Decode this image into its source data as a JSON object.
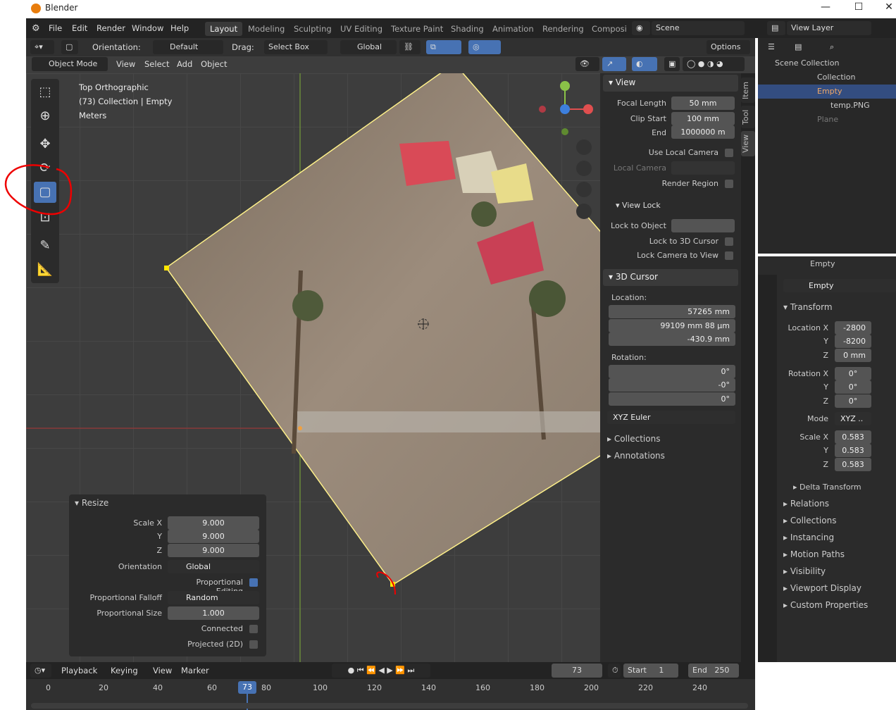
{
  "app": {
    "title": "Blender",
    "scene": "Scene",
    "view_layer": "View Layer"
  },
  "menus": [
    "File",
    "Edit",
    "Render",
    "Window",
    "Help"
  ],
  "workspaces": [
    "Layout",
    "Modeling",
    "Sculpting",
    "UV Editing",
    "Texture Paint",
    "Shading",
    "Animation",
    "Rendering",
    "Composi"
  ],
  "toolheader": {
    "orientation_label": "Orientation:",
    "orientation": "Default",
    "drag_label": "Drag:",
    "drag": "Select Box",
    "transform": "Global",
    "options": "Options"
  },
  "viewheader": {
    "mode": "Object Mode",
    "items": [
      "View",
      "Select",
      "Add",
      "Object"
    ]
  },
  "overlay": {
    "view": "Top Orthographic",
    "collection": "(73) Collection | Empty",
    "units": "Meters"
  },
  "npanel": {
    "view": {
      "title": "View",
      "focal_label": "Focal Length",
      "focal": "50 mm",
      "clip_start_label": "Clip Start",
      "clip_start": "100 mm",
      "end_label": "End",
      "end": "1000000 m",
      "use_local_camera": "Use Local Camera",
      "local_camera": "Local Camera",
      "render_region": "Render Region"
    },
    "view_lock": {
      "title": "View Lock",
      "lock_object": "Lock to Object",
      "lock_cursor": "Lock to 3D Cursor",
      "lock_camera": "Lock Camera to View"
    },
    "cursor": {
      "title": "3D Cursor",
      "location": "Location:",
      "x": "57265 mm",
      "y": "99109 mm 88 µm",
      "z": "-430.9 mm",
      "rotation": "Rotation:",
      "rx": "0°",
      "ry": "-0°",
      "rz": "0°",
      "mode": "XYZ Euler"
    },
    "collections": "Collections",
    "annotations": "Annotations",
    "tabs": [
      "Item",
      "Tool",
      "View"
    ]
  },
  "resize": {
    "title": "Resize",
    "scale_x_label": "Scale X",
    "y_label": "Y",
    "z_label": "Z",
    "sx": "9.000",
    "sy": "9.000",
    "sz": "9.000",
    "orientation_label": "Orientation",
    "orientation": "Global",
    "prop_edit": "Proportional Editing",
    "falloff_label": "Proportional Falloff",
    "falloff": "Random",
    "size_label": "Proportional Size",
    "size": "1.000",
    "connected": "Connected",
    "projected": "Projected (2D)"
  },
  "outliner": {
    "scene_collection": "Scene Collection",
    "collection": "Collection",
    "empty": "Empty",
    "image": "temp.PNG",
    "plane": "Plane"
  },
  "properties": {
    "object": "Empty",
    "name": "Empty",
    "transform": "Transform",
    "loc_x_label": "Location X",
    "loc_x": "-2800",
    "loc_y": "-8200",
    "loc_z": "0 mm",
    "rot_x_label": "Rotation X",
    "rot_x": "0°",
    "rot_y": "0°",
    "rot_z": "0°",
    "mode_label": "Mode",
    "mode": "XYZ ..",
    "scale_x_label": "Scale X",
    "scale_x": "0.583",
    "scale_y": "0.583",
    "scale_z": "0.583",
    "y": "Y",
    "z": "Z",
    "delta": "Delta Transform",
    "panels": [
      "Relations",
      "Collections",
      "Instancing",
      "Motion Paths",
      "Visibility",
      "Viewport Display",
      "Custom Properties"
    ]
  },
  "timeline": {
    "playback": "Playback",
    "keying": "Keying",
    "view": "View",
    "marker": "Marker",
    "frame": "73",
    "start_label": "Start",
    "start": "1",
    "end_label": "End",
    "end": "250",
    "ticks": [
      "0",
      "20",
      "40",
      "60",
      "80",
      "100",
      "120",
      "140",
      "160",
      "180",
      "200",
      "220",
      "240"
    ],
    "current": "73"
  }
}
